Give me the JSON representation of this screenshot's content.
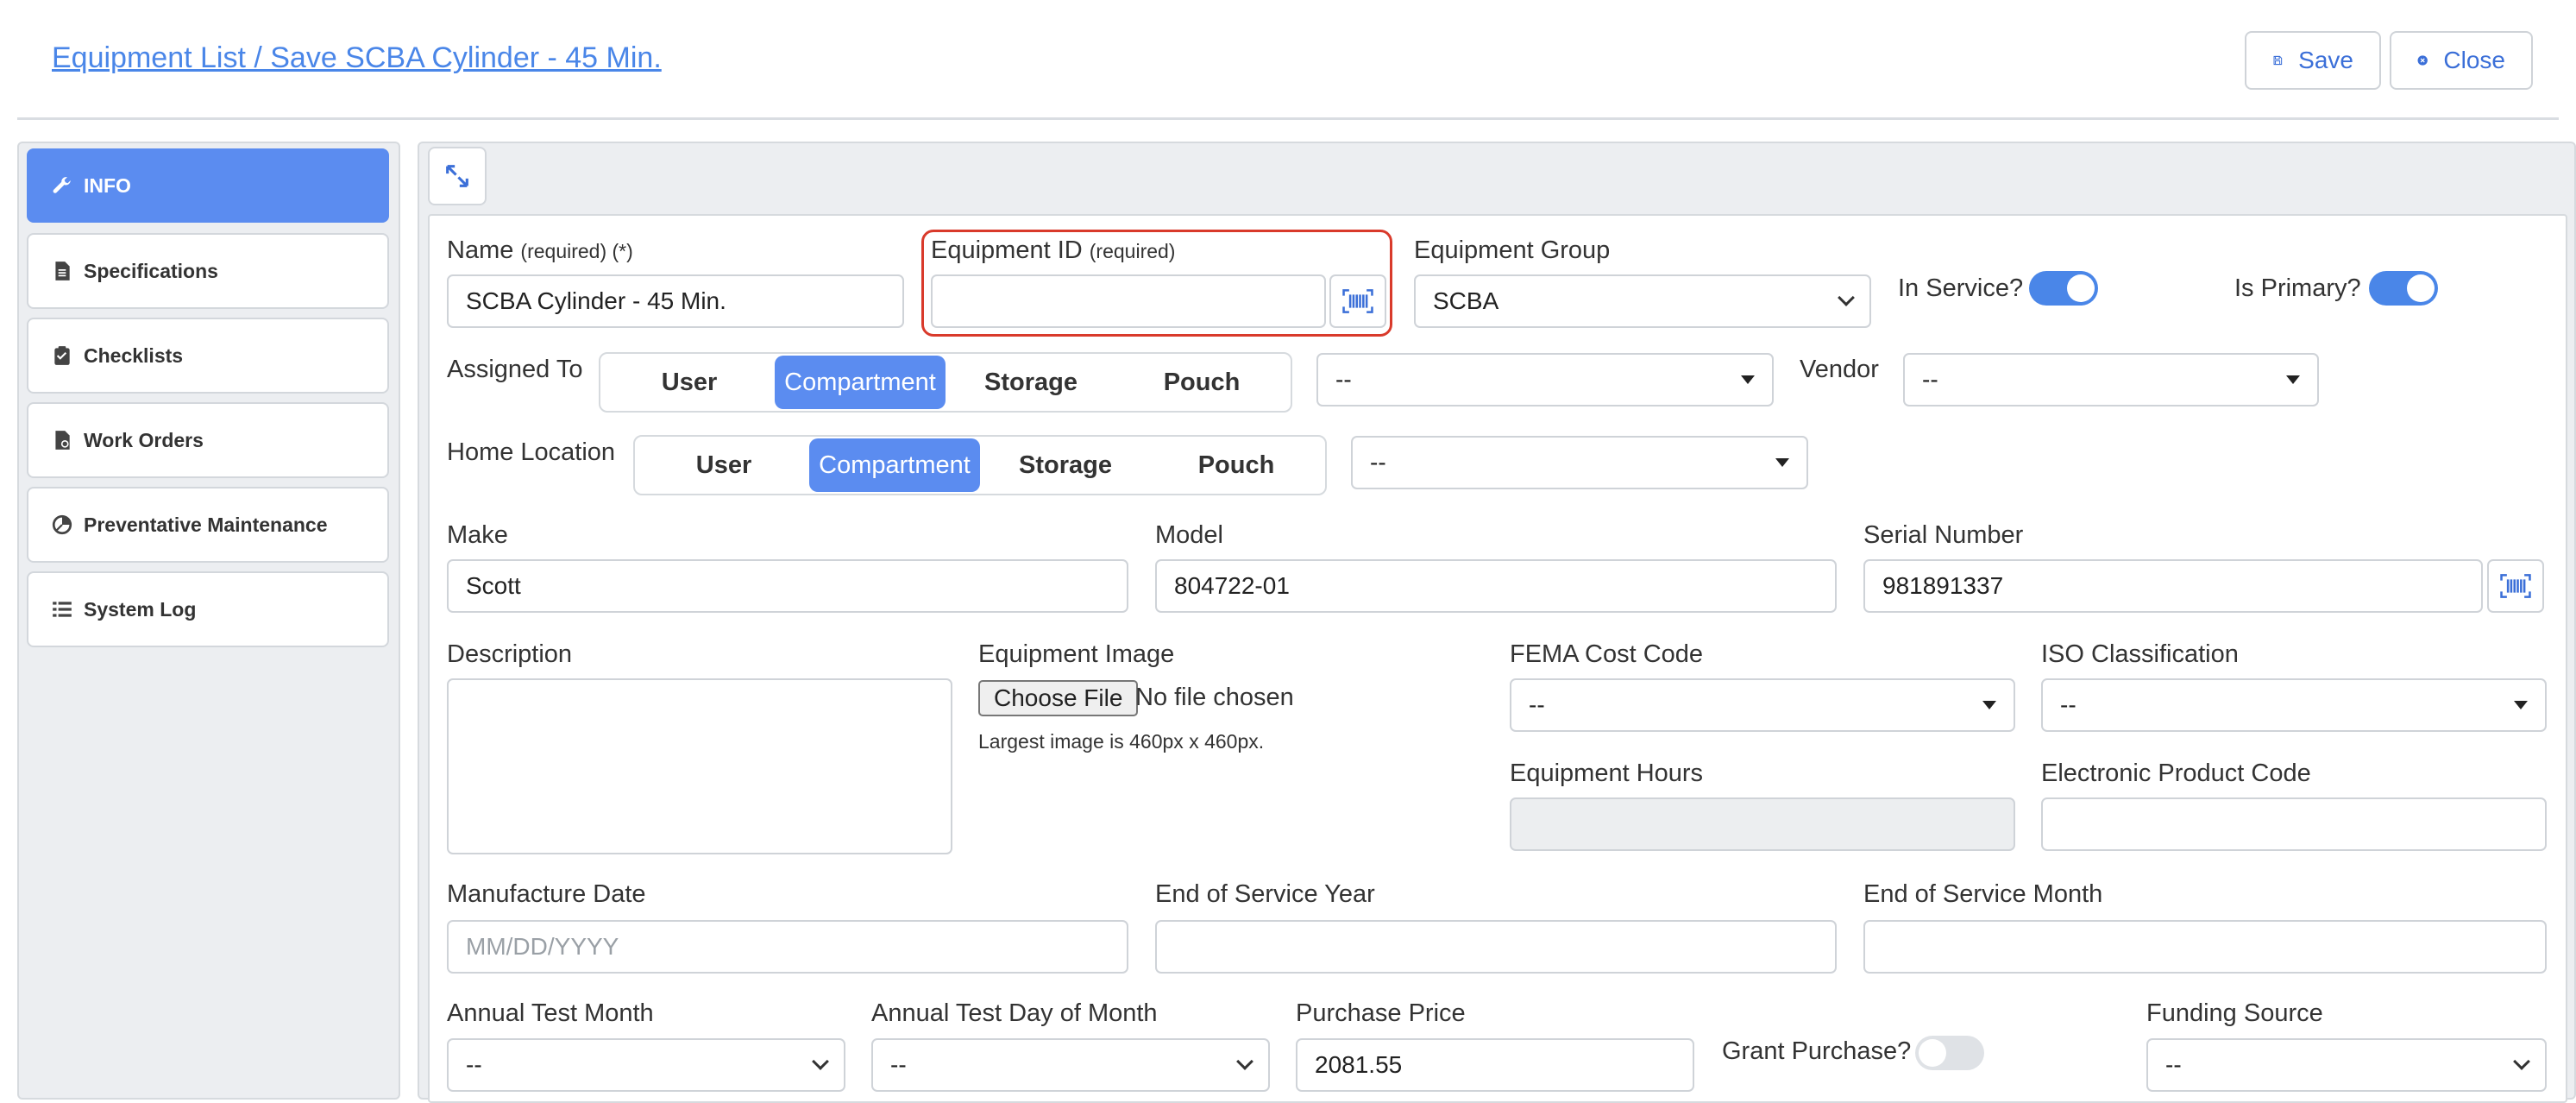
{
  "header": {
    "breadcrumb": "Equipment List / Save SCBA Cylinder - 45 Min.",
    "save_label": "Save",
    "close_label": "Close"
  },
  "sidebar": {
    "items": [
      {
        "label": "INFO",
        "icon": "wrench-icon"
      },
      {
        "label": "Specifications",
        "icon": "document-icon"
      },
      {
        "label": "Checklists",
        "icon": "clipboard-check-icon"
      },
      {
        "label": "Work Orders",
        "icon": "work-order-icon"
      },
      {
        "label": "Preventative Maintenance",
        "icon": "pie-chart-icon"
      },
      {
        "label": "System Log",
        "icon": "list-icon"
      }
    ]
  },
  "colors": {
    "accent": "#5b8cf0",
    "link": "#4a86e8",
    "required_highlight": "#d93a2b"
  },
  "form": {
    "name": {
      "label": "Name",
      "req": "(required) (*)",
      "value": "SCBA Cylinder - 45 Min."
    },
    "equipment_id": {
      "label": "Equipment ID",
      "req": "(required)",
      "value": ""
    },
    "equipment_group": {
      "label": "Equipment Group",
      "value": "SCBA"
    },
    "in_service": {
      "label": "In Service?",
      "on": true
    },
    "is_primary": {
      "label": "Is Primary?",
      "on": true
    },
    "assigned_to": {
      "label": "Assigned To",
      "options": [
        "User",
        "Compartment",
        "Storage",
        "Pouch"
      ],
      "selected": "Compartment",
      "select_value": "--"
    },
    "vendor": {
      "label": "Vendor",
      "value": "--"
    },
    "home_location": {
      "label": "Home Location",
      "options": [
        "User",
        "Compartment",
        "Storage",
        "Pouch"
      ],
      "selected": "Compartment",
      "select_value": "--"
    },
    "make": {
      "label": "Make",
      "value": "Scott"
    },
    "model": {
      "label": "Model",
      "value": "804722-01"
    },
    "serial_number": {
      "label": "Serial Number",
      "value": "981891337"
    },
    "description": {
      "label": "Description",
      "value": ""
    },
    "equipment_image": {
      "label": "Equipment Image",
      "button": "Choose File",
      "status": "No file chosen",
      "hint": "Largest image is 460px x 460px."
    },
    "fema_cost_code": {
      "label": "FEMA Cost Code",
      "value": "--"
    },
    "iso_classification": {
      "label": "ISO Classification",
      "value": "--"
    },
    "equipment_hours": {
      "label": "Equipment Hours",
      "value": ""
    },
    "electronic_product_code": {
      "label": "Electronic Product Code",
      "value": ""
    },
    "manufacture_date": {
      "label": "Manufacture Date",
      "placeholder": "MM/DD/YYYY"
    },
    "end_of_service_year": {
      "label": "End of Service Year",
      "value": ""
    },
    "end_of_service_month": {
      "label": "End of Service Month",
      "value": ""
    },
    "annual_test_month": {
      "label": "Annual Test Month",
      "value": "--"
    },
    "annual_test_day": {
      "label": "Annual Test Day of Month",
      "value": "--"
    },
    "purchase_price": {
      "label": "Purchase Price",
      "value": "2081.55"
    },
    "grant_purchase": {
      "label": "Grant Purchase?",
      "on": false
    },
    "funding_source": {
      "label": "Funding Source",
      "value": "--"
    }
  }
}
